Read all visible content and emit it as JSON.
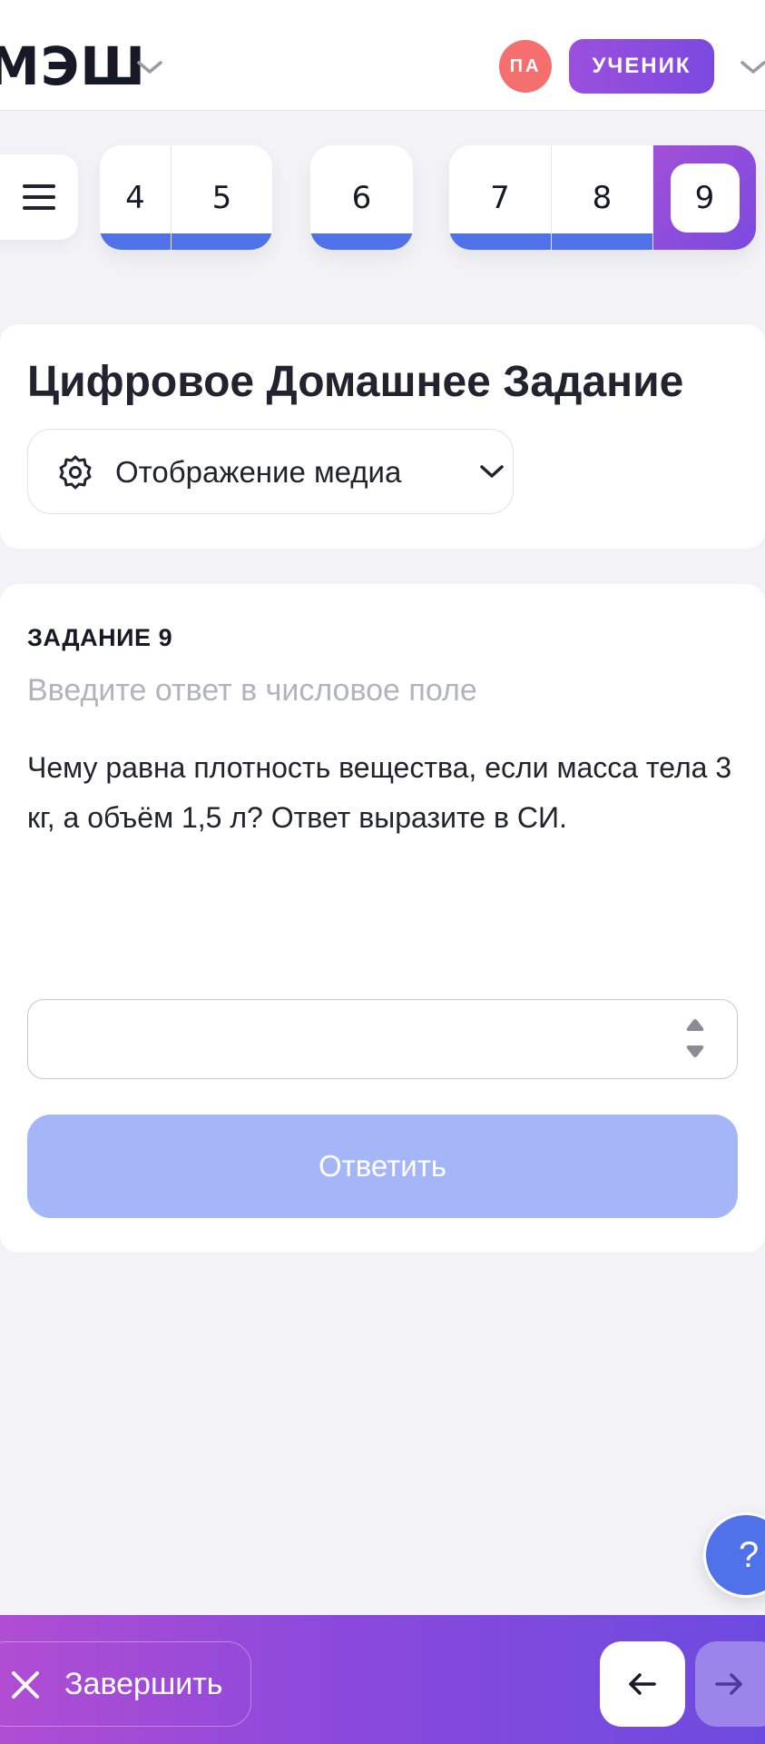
{
  "header": {
    "logo_text": "МЭШ",
    "avatar_initials": "ПА",
    "role_label": "УЧЕНИК",
    "icons": [
      "chevron-down-icon"
    ]
  },
  "task_nav": {
    "menu_icon": "hamburger-menu-icon",
    "groups": [
      {
        "items": [
          {
            "label": "4",
            "answered": true
          },
          {
            "label": "5",
            "answered": true
          }
        ]
      },
      {
        "items": [
          {
            "label": "6",
            "answered": true
          }
        ]
      },
      {
        "items": [
          {
            "label": "7",
            "answered": true
          },
          {
            "label": "8",
            "answered": true
          },
          {
            "label": "9",
            "answered": false,
            "active": true
          }
        ]
      }
    ]
  },
  "title_card": {
    "title": "Цифровое Домашнее Задание",
    "media_button_label": "Отображение медиа",
    "media_button_icon": "gear-icon"
  },
  "task": {
    "number_label": "ЗАДАНИЕ 9",
    "hint": "Введите ответ в числовое поле",
    "question": "Чему равна плотность вещества, если масса тела 3 кг, а объём 1,5 л? Ответ выразите в СИ.",
    "answer_value": "",
    "submit_label": "Ответить"
  },
  "help": {
    "label": "?"
  },
  "footer": {
    "finish_label": "Завершить",
    "finish_icon": "close-icon",
    "prev_icon": "arrow-left-icon",
    "next_icon": "arrow-right-icon"
  },
  "colors": {
    "accent_blue": "#4f72ea",
    "accent_purple": "#8a49dc",
    "avatar_red": "#f56f6f",
    "submit_disabled": "#a4b6f8"
  }
}
